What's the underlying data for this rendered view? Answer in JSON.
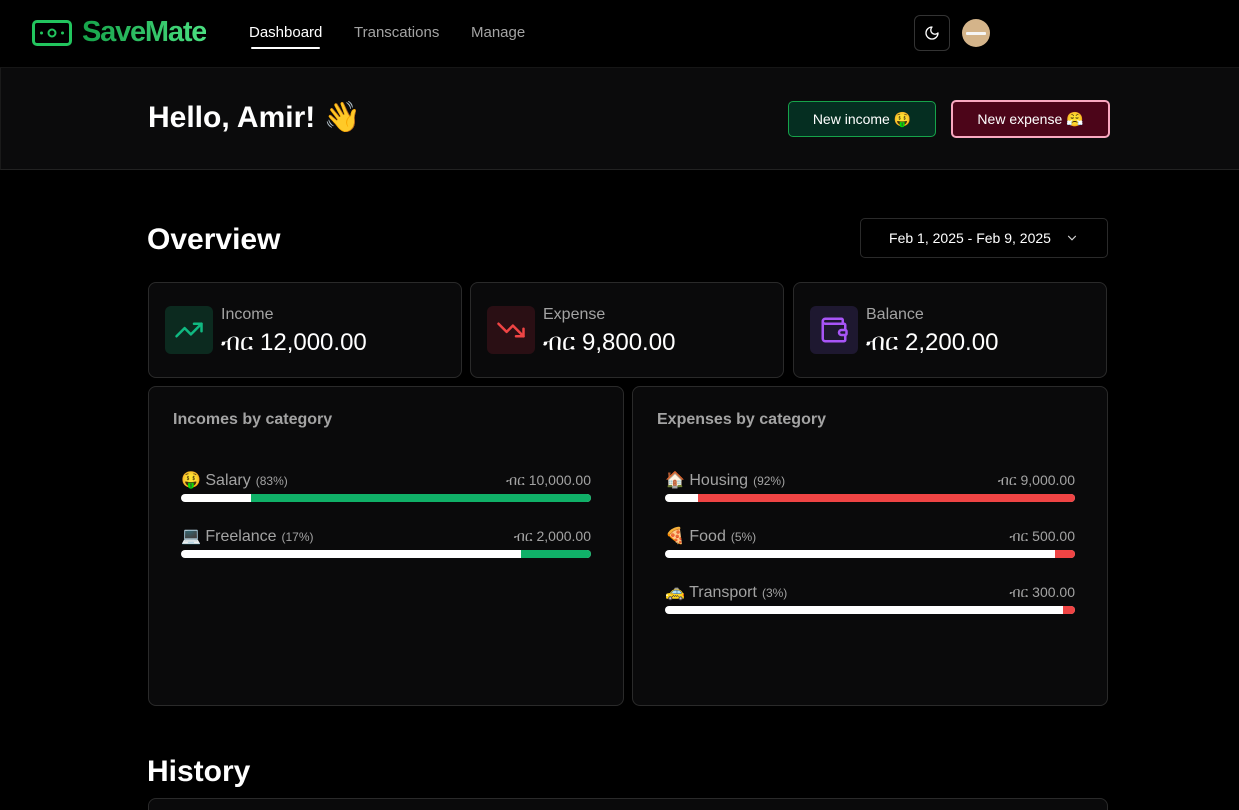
{
  "app": {
    "name": "SaveMate"
  },
  "nav": {
    "links": [
      {
        "label": "Dashboard"
      },
      {
        "label": "Transcations"
      },
      {
        "label": "Manage"
      }
    ]
  },
  "greeting": {
    "text": "Hello, Amir! 👋"
  },
  "actions": {
    "new_income": "New income 🤑",
    "new_expense": "New expense 😤"
  },
  "overview": {
    "title": "Overview",
    "date_range": "Feb 1, 2025 - Feb 9, 2025",
    "stats": [
      {
        "label": "Income",
        "value": "ብር 12,000.00",
        "icon": "trending-up-icon"
      },
      {
        "label": "Expense",
        "value": "ብር 9,800.00",
        "icon": "trending-down-icon"
      },
      {
        "label": "Balance",
        "value": "ብር 2,200.00",
        "icon": "wallet-icon"
      }
    ]
  },
  "incomes_by_category": {
    "title": "Incomes by category",
    "color": "#10b068",
    "items": [
      {
        "name": "🤑 Salary",
        "percent_label": "(83%)",
        "amount": "ብር 10,000.00",
        "percent": 83
      },
      {
        "name": "💻 Freelance",
        "percent_label": "(17%)",
        "amount": "ብር 2,000.00",
        "percent": 17
      }
    ]
  },
  "expenses_by_category": {
    "title": "Expenses by category",
    "color": "#ef4444",
    "items": [
      {
        "name": "🏠 Housing",
        "percent_label": "(92%)",
        "amount": "ብር 9,000.00",
        "percent": 92
      },
      {
        "name": "🍕 Food",
        "percent_label": "(5%)",
        "amount": "ብር 500.00",
        "percent": 5
      },
      {
        "name": "🚕 Transport",
        "percent_label": "(3%)",
        "amount": "ብር 300.00",
        "percent": 3
      }
    ]
  },
  "history": {
    "title": "History"
  }
}
